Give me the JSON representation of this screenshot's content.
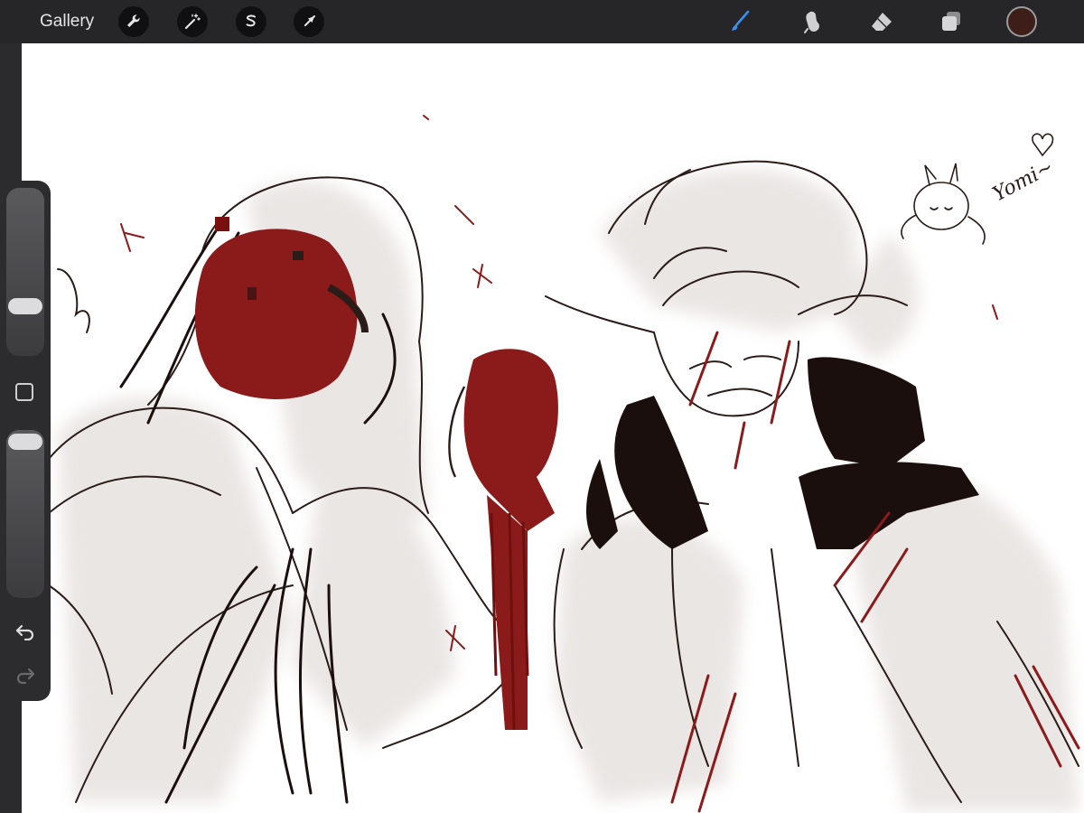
{
  "toolbar": {
    "gallery_label": "Gallery",
    "left_tools": [
      "wrench-icon",
      "magic-wand-icon",
      "selection-icon",
      "transform-arrow-icon"
    ],
    "right_tools": [
      "brush-icon",
      "smudge-icon",
      "eraser-icon",
      "layers-icon"
    ],
    "active_tool": "brush-icon",
    "active_color": "#3d1e18",
    "accent_color": "#3a8ef0"
  },
  "sidebar": {
    "brush_size_level": 0.5,
    "opacity_level": 0.0,
    "tools": [
      "slider-brush-size",
      "modify-square-icon",
      "slider-opacity",
      "undo-icon",
      "redo-icon"
    ]
  },
  "canvas": {
    "signature_text": "Yomi~",
    "ink_color": "#2a1c18",
    "blood_color": "#8b1a1a"
  }
}
